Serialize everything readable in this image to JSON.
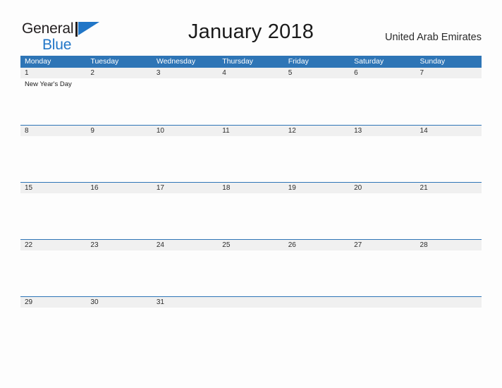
{
  "brand": {
    "name_part1": "General",
    "name_part2": "Blue",
    "flag_icon": "blue-flag-triangle-icon",
    "accent_color": "#2176c7"
  },
  "header": {
    "title": "January 2018",
    "country": "United Arab Emirates"
  },
  "colors": {
    "header_blue": "#2e75b6",
    "row_band_gray": "#f0f0f0",
    "page_background": "#fdfdfd",
    "text_dark": "#231f20"
  },
  "calendar": {
    "month": "January",
    "year": "2018",
    "weekday_headers": [
      "Monday",
      "Tuesday",
      "Wednesday",
      "Thursday",
      "Friday",
      "Saturday",
      "Sunday"
    ],
    "weeks": [
      {
        "days": [
          {
            "num": "1",
            "events": [
              "New Year's Day"
            ]
          },
          {
            "num": "2",
            "events": []
          },
          {
            "num": "3",
            "events": []
          },
          {
            "num": "4",
            "events": []
          },
          {
            "num": "5",
            "events": []
          },
          {
            "num": "6",
            "events": []
          },
          {
            "num": "7",
            "events": []
          }
        ]
      },
      {
        "days": [
          {
            "num": "8",
            "events": []
          },
          {
            "num": "9",
            "events": []
          },
          {
            "num": "10",
            "events": []
          },
          {
            "num": "11",
            "events": []
          },
          {
            "num": "12",
            "events": []
          },
          {
            "num": "13",
            "events": []
          },
          {
            "num": "14",
            "events": []
          }
        ]
      },
      {
        "days": [
          {
            "num": "15",
            "events": []
          },
          {
            "num": "16",
            "events": []
          },
          {
            "num": "17",
            "events": []
          },
          {
            "num": "18",
            "events": []
          },
          {
            "num": "19",
            "events": []
          },
          {
            "num": "20",
            "events": []
          },
          {
            "num": "21",
            "events": []
          }
        ]
      },
      {
        "days": [
          {
            "num": "22",
            "events": []
          },
          {
            "num": "23",
            "events": []
          },
          {
            "num": "24",
            "events": []
          },
          {
            "num": "25",
            "events": []
          },
          {
            "num": "26",
            "events": []
          },
          {
            "num": "27",
            "events": []
          },
          {
            "num": "28",
            "events": []
          }
        ]
      },
      {
        "days": [
          {
            "num": "29",
            "events": []
          },
          {
            "num": "30",
            "events": []
          },
          {
            "num": "31",
            "events": []
          },
          {
            "num": "",
            "events": []
          },
          {
            "num": "",
            "events": []
          },
          {
            "num": "",
            "events": []
          },
          {
            "num": "",
            "events": []
          }
        ]
      }
    ]
  }
}
